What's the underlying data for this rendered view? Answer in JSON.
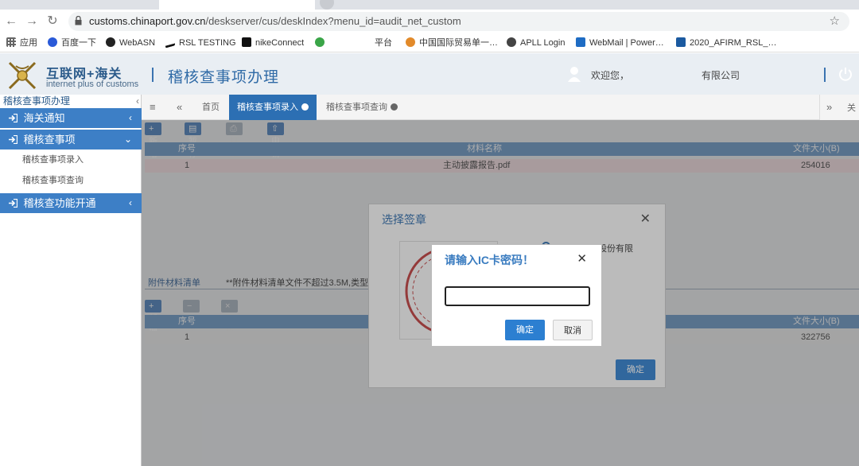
{
  "browser": {
    "url_host": "customs.chinaport.gov.cn",
    "url_path": "/deskserver/cus/deskIndex?menu_id=audit_net_custom",
    "bookmarks": [
      {
        "label": "应用",
        "icon": "apps-grid-icon"
      },
      {
        "label": "百度一下",
        "icon": "baidu-icon"
      },
      {
        "label": "WebASN",
        "icon": "webasn-icon"
      },
      {
        "label": "RSL TESTING",
        "icon": "nike-swoosh-icon"
      },
      {
        "label": "nikeConnect",
        "icon": "nike-connect-icon"
      },
      {
        "label": "平台",
        "icon": "gear-green-icon"
      },
      {
        "label": "中国国际贸易单一…",
        "icon": "single-window-icon"
      },
      {
        "label": "APLL Login",
        "icon": "apll-icon"
      },
      {
        "label": "WebMail | Power…",
        "icon": "webmail-icon"
      },
      {
        "label": "2020_AFIRM_RSL_…",
        "icon": "afirm-icon"
      }
    ]
  },
  "header": {
    "logo_cn": "互联网+海关",
    "logo_en": "internet plus of customs",
    "title": "稽核查事项办理",
    "welcome": "欢迎您，",
    "company": "有限公司"
  },
  "sidebar": {
    "top_label": "稽核查事项办理",
    "groups": [
      {
        "label": "海关通知"
      },
      {
        "label": "稽核查事项"
      },
      {
        "label": "稽核查功能开通"
      }
    ],
    "subitems": [
      {
        "label": "稽核查事项录入"
      },
      {
        "label": "稽核查事项查询"
      }
    ]
  },
  "tabs": {
    "home": "首页",
    "items": [
      {
        "label": "稽核查事项录入"
      },
      {
        "label": "稽核查事项查询"
      }
    ],
    "right_label": "关"
  },
  "materials": {
    "toolbar": [
      "新增",
      "暂存",
      "打印",
      "申请"
    ],
    "columns": [
      "序号",
      "材料名称",
      "文件大小(B)"
    ],
    "rows": [
      {
        "no": "1",
        "name": "主动披露报告.pdf",
        "size": "254016"
      }
    ]
  },
  "attachments": {
    "title": "附件材料清单",
    "note": "**附件材料清单文件不超过3.5M,类型为",
    "toolbar": [
      "新增",
      "删除",
      "下载"
    ],
    "columns": [
      "序号",
      "文件大小(B)"
    ],
    "rows": [
      {
        "no": "1",
        "size": "322756"
      }
    ]
  },
  "seal_dialog": {
    "title": "选择签章",
    "seal_name": "股份有限",
    "confirm": "确定"
  },
  "pin_dialog": {
    "title": "请输入IC卡密码！",
    "input_value": "",
    "confirm": "确定",
    "cancel": "取消"
  },
  "colors": {
    "brand_blue": "#2c6fb3",
    "menu_blue": "#3d7fc6",
    "grid_header": "#6c99c8",
    "selected_row": "#f6e0e4",
    "seal_red": "#c43a3a"
  }
}
